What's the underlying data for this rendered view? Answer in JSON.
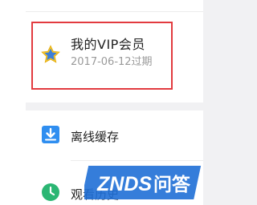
{
  "vip": {
    "title": "我的VIP会员",
    "expiry": "2017-06-12过期",
    "icon": "star-icon",
    "highlight_color": "#e23a3f"
  },
  "menu": {
    "offline": {
      "label": "离线缓存",
      "icon": "download-icon",
      "icon_color": "#2f8ef0"
    },
    "history": {
      "label": "观看历史",
      "icon": "clock-icon",
      "icon_color": "#2bb673"
    }
  },
  "watermark": {
    "brand": "ZNDS",
    "suffix": "问答"
  }
}
